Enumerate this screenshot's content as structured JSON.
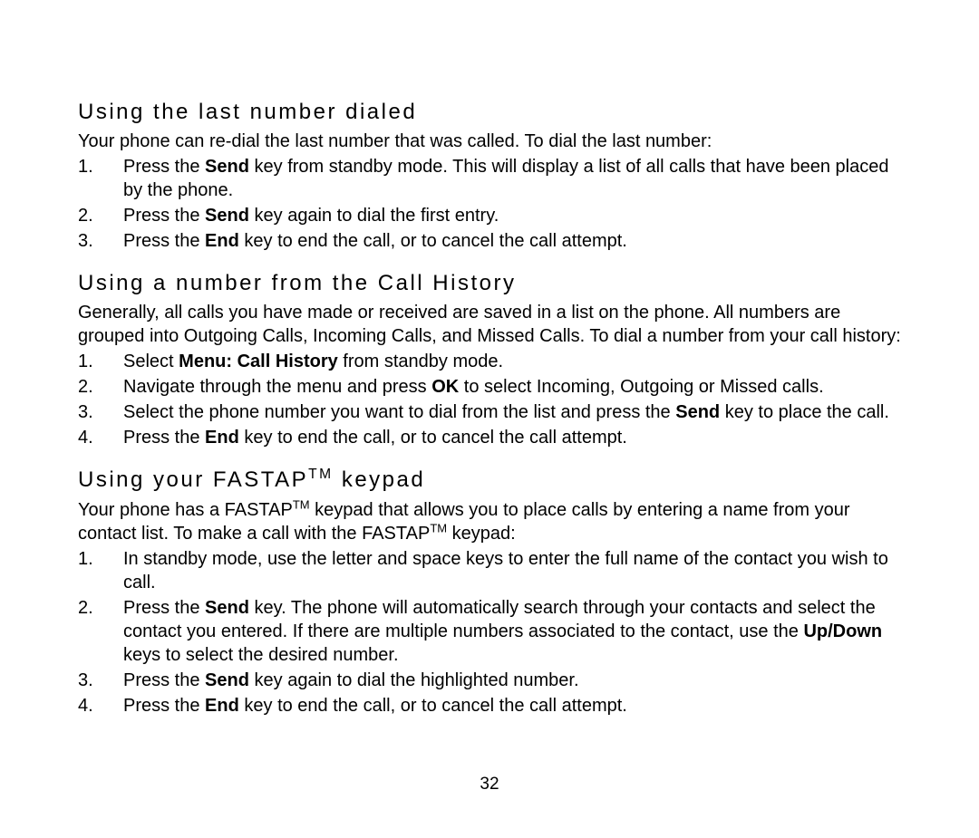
{
  "section1": {
    "heading": "Using the last number dialed",
    "intro": "Your phone can re-dial the last number that was called. To dial the last number:",
    "step1_a": "Press the ",
    "step1_b": "Send",
    "step1_c": " key from standby mode. This will display a list of all calls that have been placed by the phone.",
    "step2_a": "Press the ",
    "step2_b": "Send",
    "step2_c": " key again to dial the first entry.",
    "step3_a": "Press the ",
    "step3_b": "End",
    "step3_c": " key to end the call, or to cancel the call attempt."
  },
  "section2": {
    "heading": "Using a number from the Call History",
    "intro": "Generally, all calls you have made or received are saved in a list on the phone. All numbers are grouped into Outgoing Calls, Incoming Calls, and Missed Calls. To dial a number from your call history:",
    "step1_a": "Select ",
    "step1_b": "Menu: Call History",
    "step1_c": " from standby mode.",
    "step2_a": "Navigate through the menu and press ",
    "step2_b": "OK",
    "step2_c": " to select Incoming, Outgoing or Missed calls.",
    "step3_a": "Select the phone number you want to dial from the list and press the ",
    "step3_b": "Send",
    "step3_c": " key to place the call.",
    "step4_a": "Press the ",
    "step4_b": "End",
    "step4_c": " key to end the call, or to cancel the call attempt."
  },
  "section3": {
    "heading_a": "Using your FASTAP",
    "heading_sup": "TM",
    "heading_b": " keypad",
    "intro_a": "Your phone has a FASTAP",
    "intro_sup1": "TM",
    "intro_b": " keypad that allows you to place calls by entering a name from your contact list. To make a call with the FASTAP",
    "intro_sup2": "TM",
    "intro_c": " keypad:",
    "step1": "In standby mode, use the letter and space keys to enter the full name of the contact you wish to call.",
    "step2_a": "Press the ",
    "step2_b": "Send",
    "step2_c": " key. The phone will automatically search through your contacts and select the contact you entered. If there are multiple numbers associated to the contact, use the ",
    "step2_d": "Up/Down",
    "step2_e": " keys to select the desired number.",
    "step3_a": "Press the ",
    "step3_b": "Send",
    "step3_c": " key again to dial the highlighted number.",
    "step4_a": "Press the ",
    "step4_b": "End",
    "step4_c": " key to end the call, or to cancel the call attempt."
  },
  "pageNumber": "32"
}
